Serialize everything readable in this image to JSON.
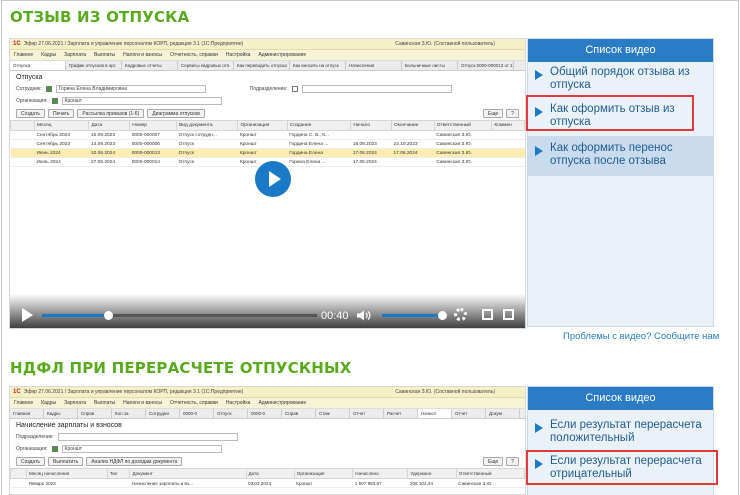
{
  "section1": {
    "title": "ОТЗЫВ ИЗ ОТПУСКА",
    "app": {
      "logo": "1С",
      "window_title": "Эфир 27.06.2021 / Зарплата и управление персоналом КОРП, редакция 3.1 (1С:Предприятие)",
      "user": "Савинская З.Ю. (Составной пользователь)",
      "menu": [
        "Главное",
        "Кадры",
        "Зарплата",
        "Выплаты",
        "Налоги и взносы",
        "Отчетность, справки",
        "Настройка",
        "Администрирование"
      ],
      "tabs": [
        "Отпуска",
        "График отпусков в орг.",
        "Кадровые отчеты",
        "Сервисы кадровых отп.",
        "Как переводить отпуска",
        "Как вносить на отпуск",
        "Начисления",
        "Больничные листы",
        "Отпуск 0000-000013 от 1",
        "Отпуск 0000-000010 от 2"
      ],
      "doc_title": "Отпуска",
      "employee_label": "Сотрудник:",
      "employee_value": "Горина Елена Владимировна",
      "division_label": "Подразделение:",
      "org_label": "Организация:",
      "org_value": "Кроншт",
      "buttons": [
        "Создать",
        "Печать",
        "Рассылка приказов (1-6)",
        "Диаграмма отпусков",
        "Еще",
        "?"
      ],
      "columns": [
        "Месяц",
        "Дата",
        "Номер",
        "Вид документа",
        "Организация",
        "Создание",
        "Начало",
        "Окончание",
        "Ответственный",
        "Коммен"
      ],
      "rows": [
        [
          "Сентябрь 2023",
          "15.09.2023",
          "0000-000007",
          "Отпуск сотрудн...",
          "Кроншт",
          "Гордина С. В., К...",
          "",
          "",
          "Савинская З.Ю."
        ],
        [
          "Сентябрь 2023",
          "14.09.2023",
          "0000-000006",
          "Отпуск",
          "Кроншт",
          "Гордина Елена ...",
          "16.09.2023",
          "22.10.2023",
          "Савинская З.Ю."
        ],
        [
          "Июнь 2024",
          "10.06.2024",
          "0000-000013",
          "Отпуск",
          "Кроншт",
          "Гордина Елена",
          "17.06.2024",
          "17.06.2024",
          "Савинская З.Ю."
        ],
        [
          "Июль 2024",
          "27.06.2024",
          "0000-000014",
          "Отпуск",
          "Кроншт",
          "Горина Елена ...",
          "17.06.2024",
          "",
          "Савинская З.Ю."
        ]
      ]
    },
    "player": {
      "time": "00:40",
      "progress": 0.24,
      "volume": 1.0
    },
    "playlist": {
      "header": "Список видео",
      "items": [
        "Общий порядок отзыва из отпуска",
        "Как оформить отзыв из отпуска",
        "Как оформить перенос отпуска после отзыва"
      ],
      "active_index": 2,
      "highlighted_index": 1
    },
    "problems_link": "Проблемы с видео? Сообщите нам"
  },
  "section2": {
    "title": "НДФЛ ПРИ ПЕРЕРАСЧЕТЕ ОТПУСКНЫХ",
    "app": {
      "logo": "1С",
      "window_title": "Эфир 27.06.2021 / Зарплата и управление персоналом КОРП, редакция 3.1 (1С:Предприятие)",
      "user": "Савинская З.Ю. (Составной пользователь)",
      "menu": [
        "Главное",
        "Кадры",
        "Зарплата",
        "Выплаты",
        "Налоги и взносы",
        "Отчетность, справки",
        "Настройка",
        "Администрирование"
      ],
      "tabs": [
        "Главная",
        "Кадры",
        "Справ",
        "Кол за",
        "Сотрудни",
        "0000-0",
        "Отпуск",
        "0000-0",
        "Справ",
        "Стаж",
        "Отчет",
        "Расчет",
        "Начисл",
        "Отчет",
        "Докум"
      ],
      "doc_title": "Начисление зарплаты и взносов",
      "division_label": "Подразделение:",
      "org_label": "Организация:",
      "org_value": "Кроншт",
      "buttons": [
        "Создать",
        "Выплатить",
        "Анализ НДФЛ по доходам документа",
        "Еще",
        "?"
      ],
      "columns": [
        "Месяц начисления",
        "Тип",
        "Документ",
        "Дата",
        "Организация",
        "Начислено",
        "Удержано",
        "Ответственный"
      ],
      "rows": [
        [
          "Январь 2023",
          "",
          "Начисление зарплаты и вз...",
          "03.02.2023",
          "Кроншт",
          "1 507 983,87",
          "206 102,44",
          "Савинская З.Ю."
        ]
      ]
    },
    "playlist": {
      "header": "Список видео",
      "items": [
        "Если результат перерасчета положительный",
        "Если результат перерасчета отрицательный"
      ],
      "highlighted_index": 1
    }
  },
  "colors": {
    "title_green": "#5aaa1e",
    "accent_blue": "#2a7cc4",
    "highlight_red": "#e0393e",
    "selected_row": "#fbedb0"
  }
}
